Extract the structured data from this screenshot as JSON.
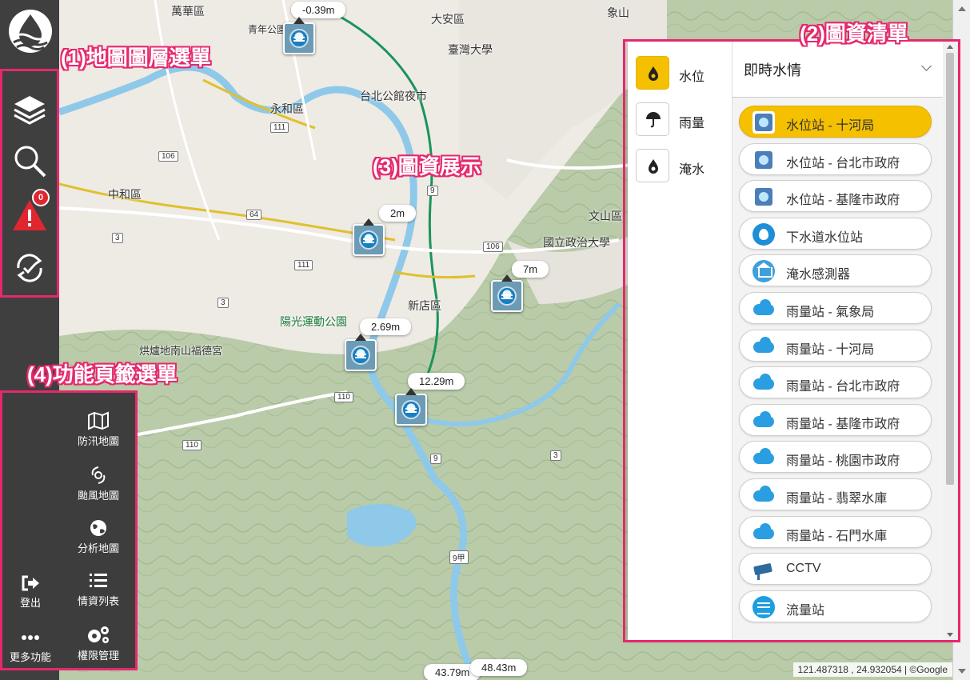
{
  "annotations": {
    "layer_menu": "(1)地圖圖層選單",
    "info_list": "(2)圖資清單",
    "info_display": "(3)圖資展示",
    "feature_tabs": "(4)功能頁籤選單"
  },
  "toolbar": {
    "icons": [
      "layers-icon",
      "search-icon",
      "warning-icon",
      "sync-check-icon"
    ],
    "alert_count": "0"
  },
  "feature_menu": {
    "items": [
      {
        "label": "防汛地圖",
        "icon": "map-icon"
      },
      {
        "label": "颱風地圖",
        "icon": "typhoon-icon"
      },
      {
        "label": "分析地圖",
        "icon": "globe-icon"
      },
      {
        "label": "情資列表",
        "icon": "list-icon"
      },
      {
        "label": "權限管理",
        "icon": "gears-icon"
      },
      {
        "label": "登出",
        "icon": "logout-icon"
      },
      {
        "label": "更多功能",
        "icon": "more-icon"
      }
    ]
  },
  "map": {
    "places": [
      "萬華區",
      "青年公園",
      "大安區",
      "臺灣大學",
      "象山",
      "台北公館夜市",
      "永和區",
      "中和區",
      "新店區",
      "文山區",
      "國立政治大學",
      "陽光運動公園",
      "烘爐地南山福德宮"
    ],
    "roads": [
      "106",
      "111",
      "64",
      "3",
      "106",
      "111",
      "3",
      "9",
      "110",
      "110",
      "9",
      "3",
      "9甲"
    ],
    "level_labels": [
      "-0.39m",
      "2m",
      "7m",
      "2.69m",
      "12.29m",
      "43.79m",
      "48.43m"
    ],
    "coords": "121.487318 , 24.932054 | ©Google"
  },
  "panel": {
    "categories": [
      {
        "label": "水位",
        "icon": "water-level-drop-icon",
        "active": true
      },
      {
        "label": "雨量",
        "icon": "umbrella-icon",
        "active": false
      },
      {
        "label": "淹水",
        "icon": "flood-drop-icon",
        "active": false
      }
    ],
    "dropdown_title": "即時水情",
    "layers": [
      {
        "label": "水位站 - 十河局",
        "icon": "water-station-icon",
        "cls": "icon-water",
        "active": true
      },
      {
        "label": "水位站 - 台北市政府",
        "icon": "water-station-icon",
        "cls": "icon-water",
        "active": false
      },
      {
        "label": "水位站 - 基隆市政府",
        "icon": "water-station-icon",
        "cls": "icon-water",
        "active": false
      },
      {
        "label": "下水道水位站",
        "icon": "sewer-station-icon",
        "cls": "icon-drop",
        "active": false
      },
      {
        "label": "淹水感測器",
        "icon": "flood-sensor-icon",
        "cls": "icon-house",
        "active": false
      },
      {
        "label": "雨量站 - 氣象局",
        "icon": "rain-station-icon",
        "cls": "icon-rain",
        "active": false
      },
      {
        "label": "雨量站 - 十河局",
        "icon": "rain-station-icon",
        "cls": "icon-rain",
        "active": false
      },
      {
        "label": "雨量站 - 台北市政府",
        "icon": "rain-station-icon",
        "cls": "icon-rain",
        "active": false
      },
      {
        "label": "雨量站 - 基隆市政府",
        "icon": "rain-station-icon",
        "cls": "icon-rain",
        "active": false
      },
      {
        "label": "雨量站 - 桃園市政府",
        "icon": "rain-station-icon",
        "cls": "icon-rain",
        "active": false
      },
      {
        "label": "雨量站 - 翡翠水庫",
        "icon": "rain-station-icon",
        "cls": "icon-rain",
        "active": false
      },
      {
        "label": "雨量站 - 石門水庫",
        "icon": "rain-station-icon",
        "cls": "icon-rain",
        "active": false
      },
      {
        "label": "CCTV",
        "icon": "cctv-icon",
        "cls": "icon-cctv",
        "active": false
      },
      {
        "label": "流量站",
        "icon": "flow-station-icon",
        "cls": "icon-flow",
        "active": false
      }
    ]
  },
  "colors": {
    "accent": "#f5c000",
    "annotation": "#e6286e",
    "toolbar": "#3f3f3f",
    "alert": "#e0262e"
  }
}
